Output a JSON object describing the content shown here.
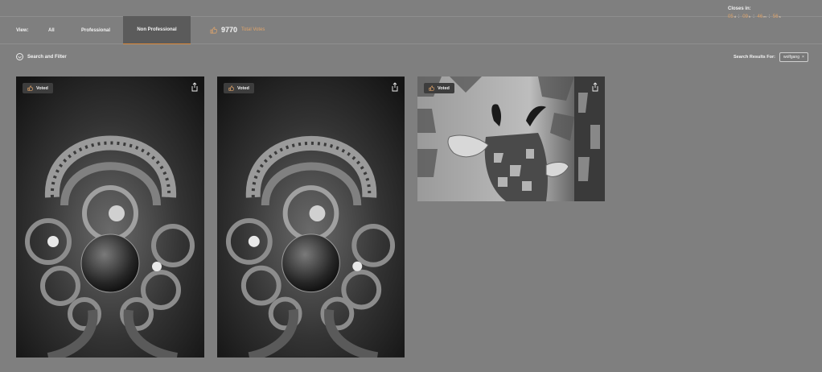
{
  "nav": {
    "view_label": "View:",
    "tabs": [
      {
        "label": "All",
        "active": false
      },
      {
        "label": "Professional",
        "active": false
      },
      {
        "label": "Non Professional",
        "active": true
      }
    ],
    "votes": {
      "count": "9770",
      "label": "Total Votes"
    }
  },
  "closes": {
    "title": "Closes in:",
    "timer": {
      "d": "05",
      "h": "09",
      "m": "46",
      "s": "56"
    }
  },
  "filter": {
    "label": "Search and Filter"
  },
  "search_results": {
    "label": "Search Results For:",
    "value": "wolfgang"
  },
  "cards": [
    {
      "badge": "Voted",
      "subject": "spherical panorama"
    },
    {
      "badge": "Voted",
      "subject": "spherical panorama"
    },
    {
      "badge": "Voted",
      "subject": "giraffe"
    }
  ],
  "colors": {
    "accent": "#e0a46a",
    "background": "#7f7f7f",
    "active_tab": "#5b5b5b"
  }
}
